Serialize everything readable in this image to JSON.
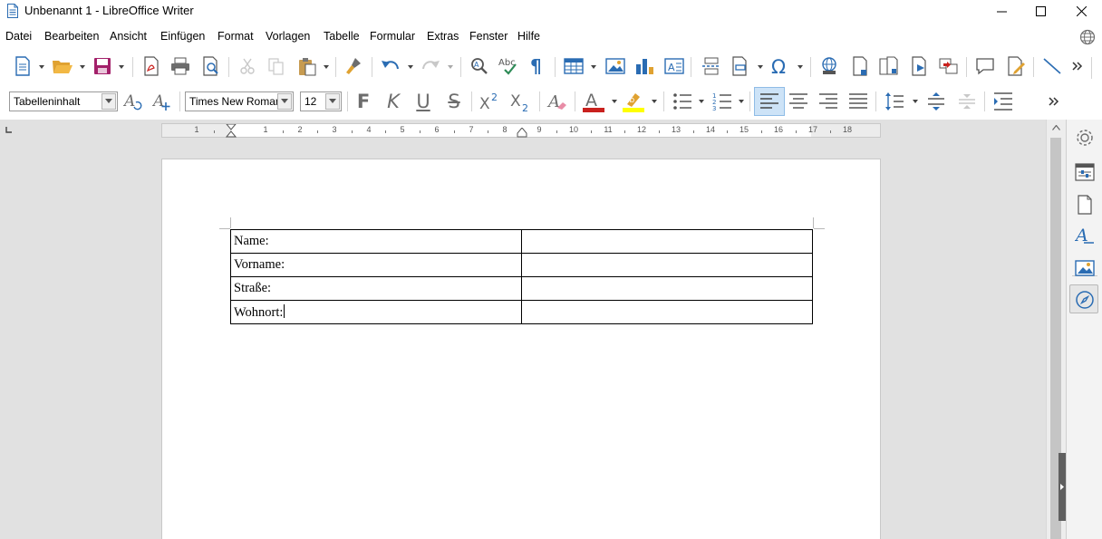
{
  "window": {
    "title": "Unbenannt 1 - LibreOffice Writer",
    "controls": [
      "minimize-icon",
      "maximize-icon",
      "close-icon"
    ]
  },
  "menu": {
    "items": [
      {
        "label": "Datei"
      },
      {
        "label": "Bearbeiten"
      },
      {
        "label": "Ansicht"
      },
      {
        "label": "Einfügen"
      },
      {
        "label": "Format"
      },
      {
        "label": "Vorlagen"
      },
      {
        "label": "Tabelle"
      },
      {
        "label": "Formular"
      },
      {
        "label": "Extras"
      },
      {
        "label": "Fenster"
      },
      {
        "label": "Hilfe"
      }
    ]
  },
  "formatting": {
    "paragraph_style": "Tabelleninhalt",
    "font_name": "Times New Roman",
    "font_size": "12",
    "bold_label": "F",
    "italic_label": "K",
    "underline_label": "U",
    "strike_label": "S"
  },
  "ruler": {
    "numbers": [
      "1",
      "1",
      "2",
      "3",
      "4",
      "5",
      "6",
      "7",
      "8",
      "9",
      "10",
      "11",
      "12",
      "13",
      "14",
      "15",
      "16",
      "17",
      "18"
    ]
  },
  "document": {
    "table": [
      {
        "label": "Name:",
        "value": ""
      },
      {
        "label": "Vorname:",
        "value": ""
      },
      {
        "label": "Straße:",
        "value": ""
      },
      {
        "label": "Wohnort:",
        "value": ""
      }
    ]
  },
  "colors": {
    "font_color": "#c9211e",
    "highlight_color": "#ffff00",
    "accent": "#2a6cb3",
    "active_bg": "#cde3f7"
  }
}
